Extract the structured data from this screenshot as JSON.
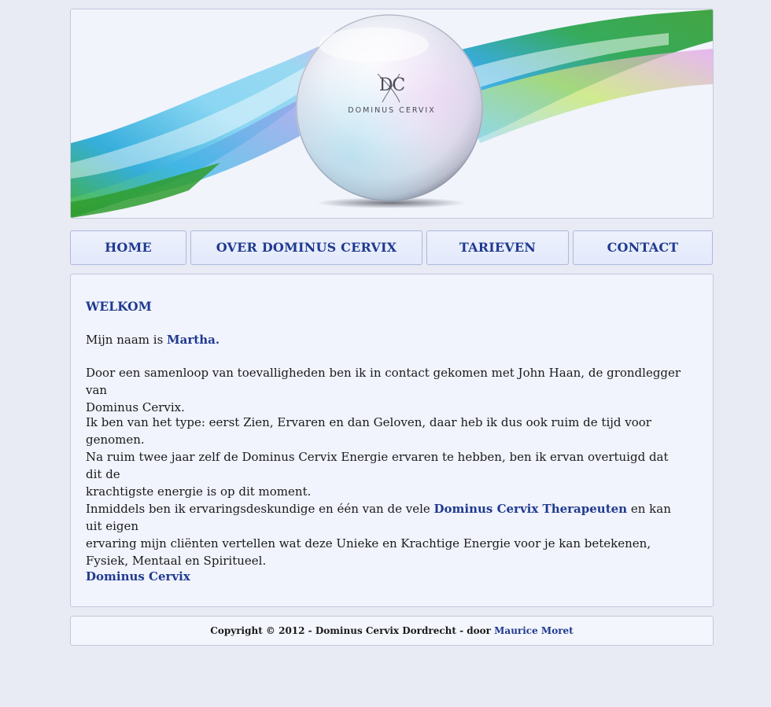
{
  "banner": {
    "logo_monogram": "DC",
    "logo_name": "DOMINUS CERVIX"
  },
  "nav": {
    "home": "HOME",
    "over": "OVER DOMINUS CERVIX",
    "tarieven": "TARIEVEN",
    "contact": "CONTACT"
  },
  "content": {
    "heading": "WELKOM",
    "p1_before": "Mijn naam is ",
    "p1_name": "Martha.",
    "p2_line1": "Door een samenloop van toevalligheden ben ik in contact gekomen met John Haan, de grondlegger van",
    "p2_line2": "Dominus Cervix.",
    "p3": "Ik ben van het type: eerst Zien, Ervaren en dan Geloven, daar heb ik dus ook ruim de tijd voor genomen.",
    "p4_line1": "Na ruim twee jaar zelf de Dominus Cervix Energie ervaren te hebben, ben ik ervan overtuigd dat dit de",
    "p4_line2": "krachtigste energie is op dit moment.",
    "p5_before": "Inmiddels ben ik ervaringsdeskundige en één van de vele ",
    "p5_link": "Dominus Cervix Therapeuten",
    "p5_after": " en kan uit eigen",
    "p5_line2": "ervaring mijn cliënten vertellen wat deze Unieke en Krachtige Energie voor je kan betekenen,",
    "p5_line3": "Fysiek, Mentaal en Spiritueel.",
    "signature": "Dominus Cervix"
  },
  "footer": {
    "copyright": "Copyright © 2012 - Dominus Cervix Dordrecht - door ",
    "author_link": "Maurice Moret"
  },
  "colors": {
    "accent": "#1f3a8f",
    "background": "#e8ebf4",
    "panel": "#f1f3fd"
  }
}
